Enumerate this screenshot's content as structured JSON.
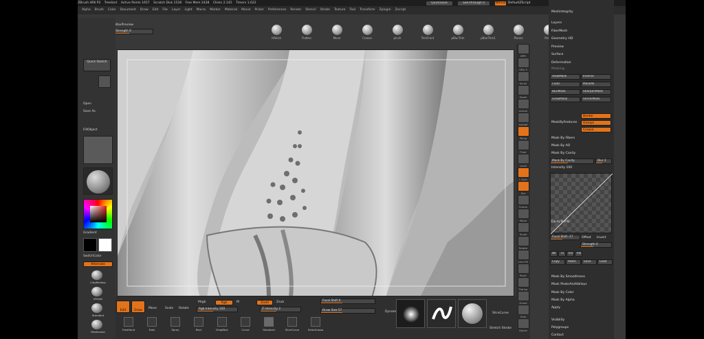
{
  "title_bar": {
    "app": "ZBrush 4R6 P2",
    "doc": "Tree4art",
    "active_points": "Active Points 1657",
    "scratch_disk": "Scratch Disk 1528",
    "free_mem": "Free Mem 2438",
    "clinks": "Clinks 2.145",
    "timers": "Timers 1.622",
    "quicksave": "QuickSave",
    "seethrough": "See-through 0",
    "menus_btn": "Menus",
    "default_script": "DefaultZScript"
  },
  "menus": [
    "Alpha",
    "Brush",
    "Color",
    "Document",
    "Draw",
    "Edit",
    "File",
    "Layer",
    "Light",
    "Macro",
    "Marker",
    "Material",
    "Movie",
    "Picker",
    "Preferences",
    "Render",
    "Stencil",
    "Stroke",
    "Texture",
    "Tool",
    "Transform",
    "Zplugin",
    "Zscript"
  ],
  "top_left": {
    "projection_master": "Projection Master",
    "lightbox": "LightBox",
    "wax_preview": "WaxPreview",
    "strength": "Strength 0"
  },
  "brush_tools": [
    "hPolish",
    "Flatten",
    "Move",
    "Crease",
    "pinch",
    "TrimFront",
    "pBlurTrim",
    "pBlurTrim1",
    "Planes",
    "Polish"
  ],
  "left_panel": {
    "quick_sketch": "Quick Sketch",
    "open": "Open",
    "save_as": "Save As",
    "fill_object": "FillObject",
    "gradient": "Gradient",
    "switch_color": "SwitchColor",
    "alternate": "Alternate",
    "brushes": [
      "ClayBuildup",
      "hPolish",
      "Standard",
      "MaskLasso"
    ]
  },
  "right_shelf": [
    "BPR",
    "SPix 3",
    "Scroll",
    "Zoom",
    "Actual",
    "AAHalf",
    "Persp",
    "Floor",
    "Local",
    "L.Sym",
    "Xyz",
    "Frame",
    "Move",
    "Scale",
    "Rotate",
    "Line Fill",
    "PolyF",
    "Transp",
    "Ghost",
    "Solo",
    "Xpose"
  ],
  "bottom_bar": {
    "edit": "Edit",
    "draw": "Draw",
    "move": "Move",
    "scale": "Scale",
    "rotate": "Rotate",
    "mrgb": "Mrgb",
    "rgb": "Rgb",
    "m": "M",
    "zadd": "Zadd",
    "zsub": "Zsub",
    "rgb_intensity": "Rgb Intensity 100",
    "z_intensity": "Z Intensity 2",
    "focal_shift": "Focal Shift 0",
    "draw_size": "Draw Size 57",
    "dynamic": "Dynamic",
    "stroke_icons": [
      "FreeHand",
      "Dots",
      "Spray",
      "Rect",
      "DragRect",
      "Curve",
      "Standard",
      "SliceCurve",
      "SelectLasso"
    ],
    "curve_buttons": [
      "SliceCurve",
      "Stretch Stroke"
    ],
    "current_brush": "ClayBuildup"
  },
  "right_panel": {
    "top_items": [
      "MeshIntegrity",
      "Layers",
      "FiberMesh",
      "Geometry HD",
      "Preview",
      "Surface",
      "Deformation"
    ],
    "masking": "Masking",
    "mask_buttons": [
      [
        "ViewMask",
        "Inverse"
      ],
      [
        "Clear",
        "MaskAll"
      ],
      [
        "BlurMask",
        "SharpenMask"
      ],
      [
        "GrowMask",
        "ShrinkMask"
      ]
    ],
    "mask_by_features": "MaskByFeatures",
    "feature_buttons": [
      "Border",
      "Groups",
      "Crease"
    ],
    "mask_by_fibers": "Mask By Fibers",
    "mask_by_ao": "Mask By AO",
    "mask_by_cavity": "Mask By Cavity",
    "cavity_slider": "Mask By Cavity",
    "blur": "Blur 2",
    "intensity": "Intensity 100",
    "cavity_profile": "Cavity Profile",
    "focal_shift": "Focal Shift -17",
    "offset": "Offset",
    "invert": "Invert",
    "strength": "Strength 0",
    "small_buttons": [
      "Wr",
      "Tx",
      "Invert",
      "Pol"
    ],
    "copy_btns": [
      "Copy",
      "Paste",
      "Save",
      "Load"
    ],
    "smoothness": "Mask By Smoothness",
    "peaks": "Mask PeaksAndValleys",
    "by_color": "Mask By Color",
    "by_alpha": "Mask By Alpha",
    "apply": "Apply",
    "bottom_items": [
      "Visibility",
      "Polygroups",
      "Contact"
    ]
  }
}
